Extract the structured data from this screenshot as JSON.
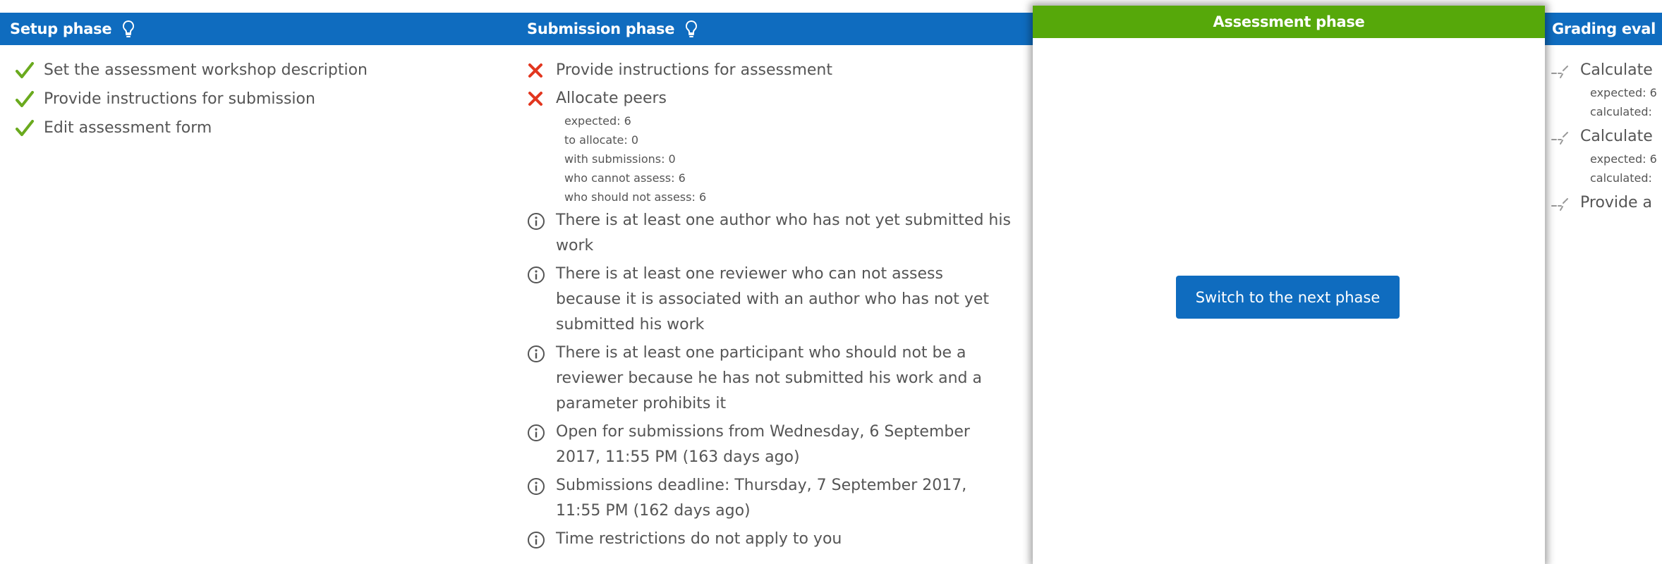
{
  "setup": {
    "title": "Setup phase",
    "tasks": [
      {
        "label": "Set the assessment workshop description",
        "status": "done"
      },
      {
        "label": "Provide instructions for submission",
        "status": "done"
      },
      {
        "label": "Edit assessment form",
        "status": "done"
      }
    ]
  },
  "submission": {
    "title": "Submission phase",
    "tasks": [
      {
        "label": "Provide instructions for assessment",
        "status": "fail"
      },
      {
        "label": "Allocate peers",
        "status": "fail"
      },
      {
        "label": "There is at least one author who has not yet submitted his work",
        "status": "info"
      },
      {
        "label": "There is at least one reviewer who can not assess because it is associated with an author who has not yet submitted his work",
        "status": "info"
      },
      {
        "label": "There is at least one participant who should not be a reviewer because he has not submitted his work and a parameter prohibits it",
        "status": "info"
      },
      {
        "label": "Open for submissions from Wednesday, 6 September 2017, 11:55 PM (163 days ago)",
        "status": "info"
      },
      {
        "label": "Submissions deadline: Thursday, 7 September 2017, 11:55 PM (162 days ago)",
        "status": "info"
      },
      {
        "label": "Time restrictions do not apply to you",
        "status": "info"
      }
    ],
    "allocation_details": [
      "expected: 6",
      "to allocate: 0",
      "with submissions: 0",
      "who cannot assess: 6",
      "who should not assess: 6"
    ]
  },
  "assessment": {
    "title": "Assessment phase",
    "switch_button": "Switch to the next phase"
  },
  "grading": {
    "title": "Grading eval",
    "tasks": [
      {
        "label": "Calculate",
        "details": [
          "expected: 6",
          "calculated:"
        ]
      },
      {
        "label": "Calculate",
        "details": [
          "expected: 6",
          "calculated:"
        ]
      },
      {
        "label": "Provide a",
        "details": []
      }
    ]
  },
  "colors": {
    "header_blue": "#0f6cbf",
    "active_green": "#56a80a",
    "check_green": "#6aaa1e",
    "fail_red": "#e2361f"
  }
}
